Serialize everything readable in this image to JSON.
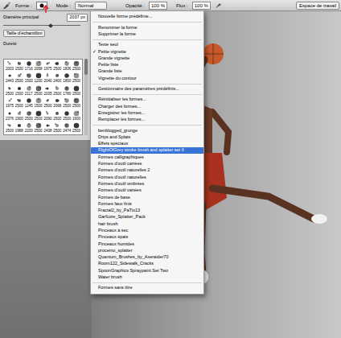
{
  "toolbar": {
    "tool_label": "Forme :",
    "mode_label": "Mode :",
    "mode": "Normal",
    "opacity_label": "Opacité :",
    "opacity": "100 %",
    "flow_label": "Flux :",
    "flow": "100 %",
    "workspace": "Espace de travail"
  },
  "brush_panel": {
    "diameter_label": "Diamètre principal",
    "diameter": "2037 px",
    "diameter_level": 0.62,
    "sample_button": "Taille d'échantillon",
    "hardness_label": "Dureté",
    "brushes": [
      "2003",
      "1500",
      "1716",
      "2068",
      "1975",
      "2500",
      "1836",
      "2500",
      "2443",
      "2500",
      "1500",
      "1200",
      "2040",
      "2400",
      "1800",
      "2500",
      "2500",
      "1500",
      "2117",
      "2500",
      "2035",
      "2500",
      "1780",
      "2500",
      "1975",
      "2500",
      "1245",
      "1500",
      "2500",
      "2068",
      "2500",
      "2500",
      "2376",
      "1900",
      "2500",
      "2500",
      "2090",
      "2500",
      "2500",
      "1600",
      "2500",
      "1988",
      "2200",
      "2500",
      "2438",
      "2500",
      "2474",
      "2500"
    ]
  },
  "menu": {
    "check_mark": "✓",
    "items": [
      {
        "kind": "item",
        "label": "Nouvelle forme prédéfinie...",
        "checked": false,
        "selected": false
      },
      {
        "kind": "separator"
      },
      {
        "kind": "item",
        "label": "Renommer la forme",
        "checked": false,
        "selected": false
      },
      {
        "kind": "item",
        "label": "Supprimer la forme",
        "checked": false,
        "selected": false
      },
      {
        "kind": "separator"
      },
      {
        "kind": "item",
        "label": "Texte seul",
        "checked": false,
        "selected": false
      },
      {
        "kind": "item",
        "label": "Petite vignette",
        "checked": true,
        "selected": false
      },
      {
        "kind": "item",
        "label": "Grande vignette",
        "checked": false,
        "selected": false
      },
      {
        "kind": "item",
        "label": "Petite liste",
        "checked": false,
        "selected": false
      },
      {
        "kind": "item",
        "label": "Grande liste",
        "checked": false,
        "selected": false
      },
      {
        "kind": "item",
        "label": "Vignette du contour",
        "checked": false,
        "selected": false
      },
      {
        "kind": "separator"
      },
      {
        "kind": "item",
        "label": "Gestionnaire des paramètres prédéfinis...",
        "checked": false,
        "selected": false
      },
      {
        "kind": "separator"
      },
      {
        "kind": "item",
        "label": "Réinitialiser les formes...",
        "checked": false,
        "selected": false
      },
      {
        "kind": "item",
        "label": "Charger des formes...",
        "checked": false,
        "selected": false
      },
      {
        "kind": "item",
        "label": "Enregistrer les formes...",
        "checked": false,
        "selected": false
      },
      {
        "kind": "item",
        "label": "Remplacer les formes...",
        "checked": false,
        "selected": false
      },
      {
        "kind": "separator"
      },
      {
        "kind": "item",
        "label": "benblogged_grunge",
        "checked": false,
        "selected": false
      },
      {
        "kind": "item",
        "label": "Drips and Splats",
        "checked": false,
        "selected": false
      },
      {
        "kind": "item",
        "label": "Effets spéciaux",
        "checked": false,
        "selected": false
      },
      {
        "kind": "item",
        "label": "FlightOfGrey stroke brush and splatter set II",
        "checked": false,
        "selected": true
      },
      {
        "kind": "item",
        "label": "Formes calligraphiques",
        "checked": false,
        "selected": false
      },
      {
        "kind": "item",
        "label": "Formes d'outil carrées",
        "checked": false,
        "selected": false
      },
      {
        "kind": "item",
        "label": "Formes d'outil naturelles 2",
        "checked": false,
        "selected": false
      },
      {
        "kind": "item",
        "label": "Formes d'outil naturelles",
        "checked": false,
        "selected": false
      },
      {
        "kind": "item",
        "label": "Formes d'outil ombrées",
        "checked": false,
        "selected": false
      },
      {
        "kind": "item",
        "label": "Formes d'outil variées",
        "checked": false,
        "selected": false
      },
      {
        "kind": "item",
        "label": "Formes de base",
        "checked": false,
        "selected": false
      },
      {
        "kind": "item",
        "label": "Formes faux finis",
        "checked": false,
        "selected": false
      },
      {
        "kind": "item",
        "label": "Fractal2_by_PaTio13",
        "checked": false,
        "selected": false
      },
      {
        "kind": "item",
        "label": "Garfcore_Splatter_Pack",
        "checked": false,
        "selected": false
      },
      {
        "kind": "item",
        "label": "hair brush",
        "checked": false,
        "selected": false
      },
      {
        "kind": "item",
        "label": "Pinceaux à sec",
        "checked": false,
        "selected": false
      },
      {
        "kind": "item",
        "label": "Pinceaux épais",
        "checked": false,
        "selected": false
      },
      {
        "kind": "item",
        "label": "Pinceaux humides",
        "checked": false,
        "selected": false
      },
      {
        "kind": "item",
        "label": "procemo_splatter",
        "checked": false,
        "selected": false
      },
      {
        "kind": "item",
        "label": "Quantum_Brushes_by_Axeraider70",
        "checked": false,
        "selected": false
      },
      {
        "kind": "item",
        "label": "Room122_Sidewalk_Cracks",
        "checked": false,
        "selected": false
      },
      {
        "kind": "item",
        "label": "SpoonGraphics Spraypaint Set Two",
        "checked": false,
        "selected": false
      },
      {
        "kind": "item",
        "label": "Water brush",
        "checked": false,
        "selected": false
      },
      {
        "kind": "separator"
      },
      {
        "kind": "item",
        "label": "Formes sans titre",
        "checked": false,
        "selected": false
      }
    ]
  }
}
